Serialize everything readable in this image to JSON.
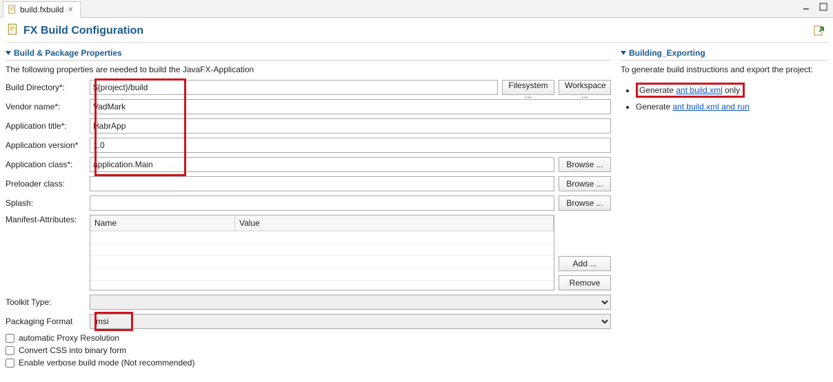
{
  "tab": {
    "filename": "build.fxbuild"
  },
  "page": {
    "title": "FX Build Configuration"
  },
  "sections": {
    "left": {
      "title": "Build & Package Properties",
      "desc": "The following properties are needed to build the JavaFX-Application"
    },
    "right": {
      "title": "Building_Exporting",
      "desc": "To generate build instructions and export the project:"
    }
  },
  "fields": {
    "buildDir": {
      "label": "Build Directory*:",
      "value": "${project}/build"
    },
    "vendor": {
      "label": "Vendor name*:",
      "value": "VadMark"
    },
    "appTitle": {
      "label": "Application title*:",
      "value": "HabrApp"
    },
    "appVersion": {
      "label": "Application version*",
      "value": "1.0"
    },
    "appClass": {
      "label": "Application class*:",
      "value": "application.Main"
    },
    "preloader": {
      "label": "Preloader class:",
      "value": ""
    },
    "splash": {
      "label": "Splash:",
      "value": ""
    },
    "manifest": {
      "label": "Manifest-Attributes:"
    },
    "toolkit": {
      "label": "Toolkit Type:",
      "value": ""
    },
    "packaging": {
      "label": "Packaging Format",
      "value": "msi"
    }
  },
  "buttons": {
    "filesystem": "Filesystem ...",
    "workspace": "Workspace ...",
    "browse": "Browse ...",
    "add": "Add ...",
    "remove": "Remove"
  },
  "table": {
    "colName": "Name",
    "colValue": "Value"
  },
  "checks": {
    "proxy": "automatic Proxy Resolution",
    "css": "Convert CSS into binary form",
    "verbose": "Enable verbose build mode (Not recommended)"
  },
  "export": {
    "gen1_prefix": "Generate ",
    "gen1_link": "ant build.xml",
    "gen1_suffix": " only",
    "gen2_prefix": "Generate ",
    "gen2_link": "ant build.xml and run"
  }
}
